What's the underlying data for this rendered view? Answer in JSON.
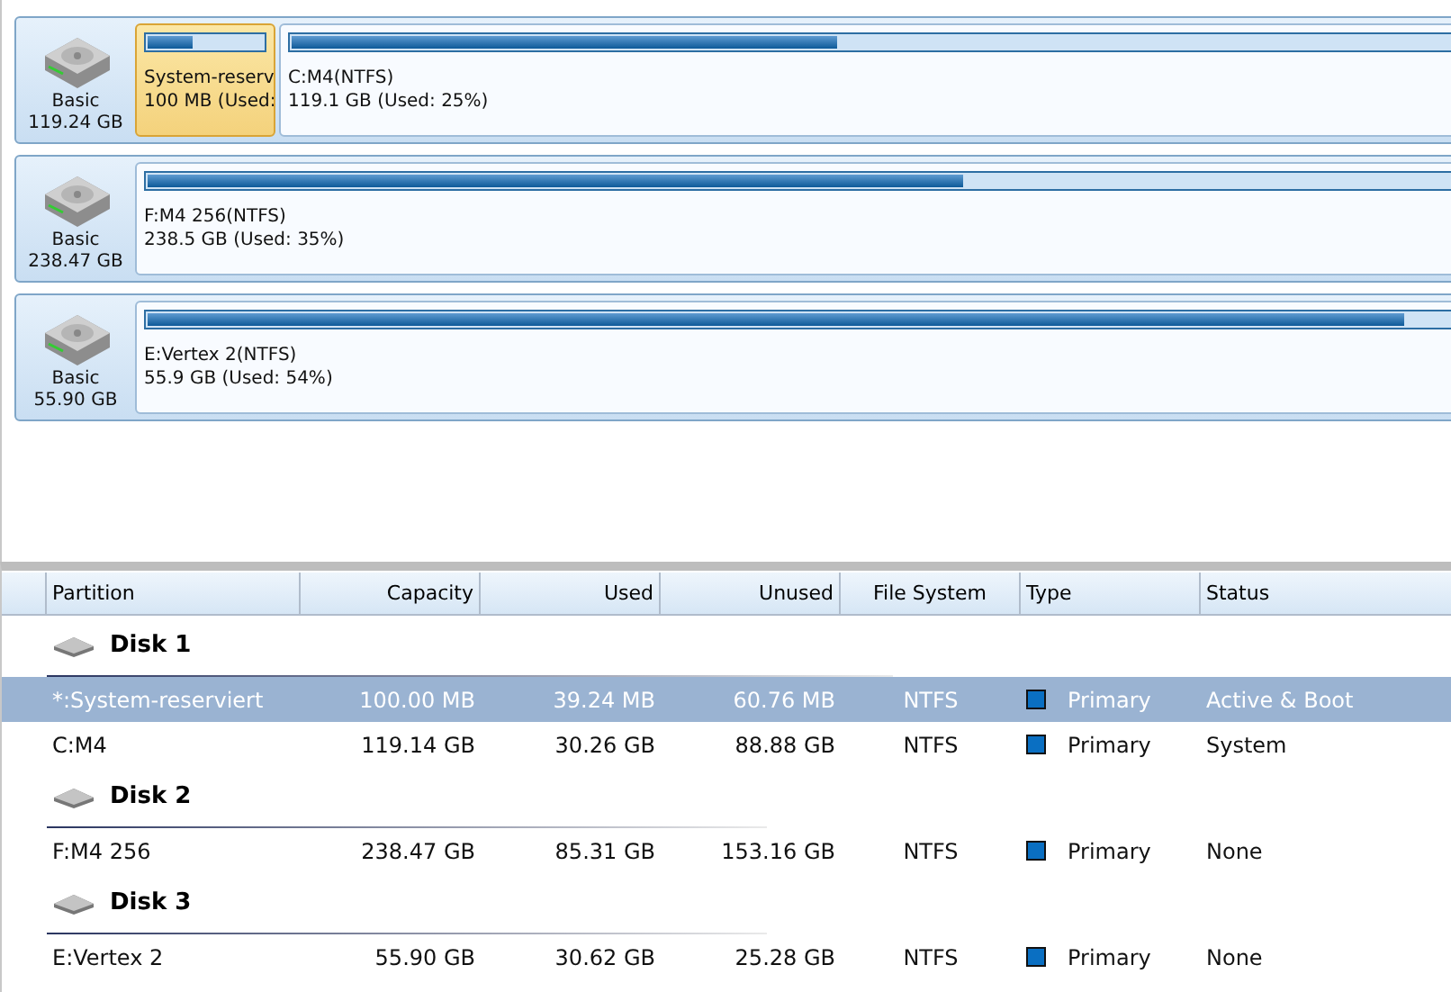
{
  "disk_map": [
    {
      "kind": "Basic",
      "size": "119.24 GB",
      "partitions": [
        {
          "name": "System-reserv",
          "detail": "100 MB (Used:",
          "level": 0.39,
          "selected": true
        },
        {
          "name": "C:M4(NTFS)",
          "detail": "119.1 GB (Used: 25%)",
          "level": 0.25,
          "selected": false
        }
      ]
    },
    {
      "kind": "Basic",
      "size": "238.47 GB",
      "partitions": [
        {
          "name": "F:M4 256(NTFS)",
          "detail": "238.5 GB (Used: 35%)",
          "level": 0.35,
          "selected": false
        }
      ]
    },
    {
      "kind": "Basic",
      "size": "55.90 GB",
      "partitions": [
        {
          "name": "E:Vertex 2(NTFS)",
          "detail": "55.9 GB (Used: 54%)",
          "level": 0.54,
          "selected": false
        }
      ]
    }
  ],
  "table": {
    "columns": [
      "Partition",
      "Capacity",
      "Used",
      "Unused",
      "File System",
      "Type",
      "Status"
    ],
    "disks": [
      {
        "label": "Disk 1",
        "rows": [
          {
            "partition": "*:System-reserviert",
            "capacity": "100.00 MB",
            "used": "39.24 MB",
            "unused": "60.76 MB",
            "file_system": "NTFS",
            "type": "Primary",
            "color": "#0a6fc2",
            "status": "Active & Boot",
            "selected": true
          },
          {
            "partition": "C:M4",
            "capacity": "119.14 GB",
            "used": "30.26 GB",
            "unused": "88.88 GB",
            "file_system": "NTFS",
            "type": "Primary",
            "color": "#0a6fc2",
            "status": "System",
            "selected": false
          }
        ]
      },
      {
        "label": "Disk 2",
        "rows": [
          {
            "partition": "F:M4 256",
            "capacity": "238.47 GB",
            "used": "85.31 GB",
            "unused": "153.16 GB",
            "file_system": "NTFS",
            "type": "Primary",
            "color": "#0a6fc2",
            "status": "None",
            "selected": false
          }
        ]
      },
      {
        "label": "Disk 3",
        "rows": [
          {
            "partition": "E:Vertex 2",
            "capacity": "55.90 GB",
            "used": "30.62 GB",
            "unused": "25.28 GB",
            "file_system": "NTFS",
            "type": "Primary",
            "color": "#0a6fc2",
            "status": "None",
            "selected": false
          }
        ]
      }
    ]
  }
}
